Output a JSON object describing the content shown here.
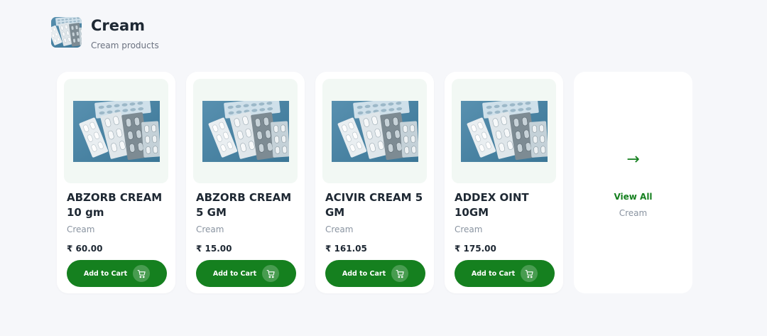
{
  "header": {
    "title": "Cream",
    "subtitle": "Cream products",
    "thumbnail_icon": "medicine-blister-image"
  },
  "products": [
    {
      "name": "ABZORB CREAM 10 gm",
      "category": "Cream",
      "price": "₹ 60.00",
      "button_label": "Add to Cart"
    },
    {
      "name": "ABZORB CREAM 5 GM",
      "category": "Cream",
      "price": "₹ 15.00",
      "button_label": "Add to Cart"
    },
    {
      "name": "ACIVIR CREAM 5 GM",
      "category": "Cream",
      "price": "₹ 161.05",
      "button_label": "Add to Cart"
    },
    {
      "name": "ADDEX OINT 10GM",
      "category": "Cream",
      "price": "₹ 175.00",
      "button_label": "Add to Cart"
    }
  ],
  "view_all": {
    "arrow": "→",
    "label": "View All",
    "category": "Cream"
  },
  "colors": {
    "accent": "#15801f",
    "background": "#f6f7fa",
    "image_bg": "#f2f8f4"
  }
}
